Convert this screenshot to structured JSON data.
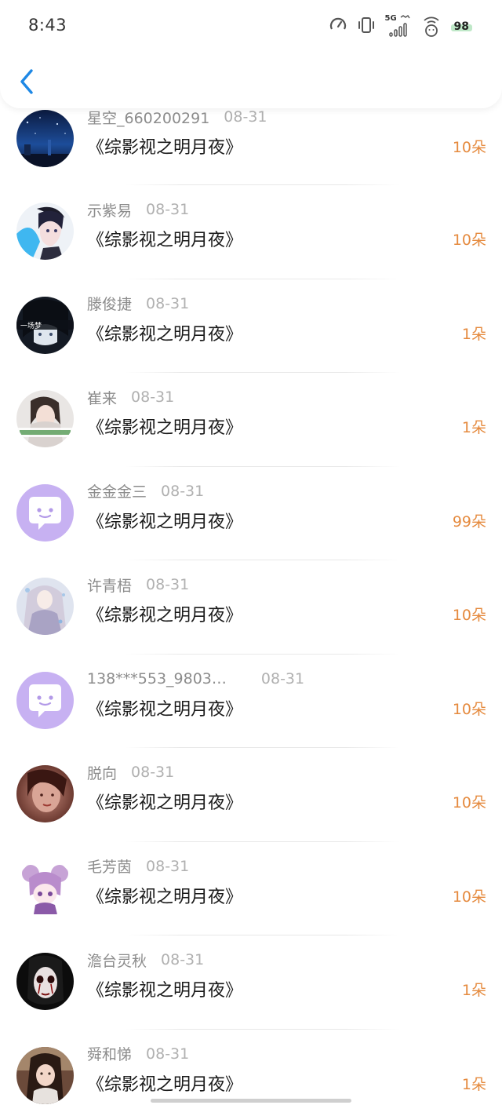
{
  "status_bar": {
    "time": "8:43",
    "network_label": "5G",
    "battery": "98"
  },
  "colors": {
    "accent_blue": "#1e88e5",
    "count_orange": "#e58a3e",
    "default_avatar_purple": "#c7b1f2"
  },
  "icons": {
    "back": "chevron-left-icon",
    "default_avatar": "chat-bubble-face-icon"
  },
  "gifts": [
    {
      "user": "星空_660200291",
      "date": "08-31",
      "book": "《综影视之明月夜》",
      "count": "10朵",
      "avatar": "night-sky-photo"
    },
    {
      "user": "示紫易",
      "date": "08-31",
      "book": "《综影视之明月夜》",
      "count": "10朵",
      "avatar": "anime-boy-blue-photo"
    },
    {
      "user": "滕俊捷",
      "date": "08-31",
      "book": "《综影视之明月夜》",
      "count": "1朵",
      "avatar": "dark-anime-photo",
      "avatar_text": "一场梦"
    },
    {
      "user": "崔来",
      "date": "08-31",
      "book": "《综影视之明月夜》",
      "count": "1朵",
      "avatar": "girl-portrait-photo"
    },
    {
      "user": "金金金三",
      "date": "08-31",
      "book": "《综影视之明月夜》",
      "count": "99朵",
      "avatar": "default-purple-avatar"
    },
    {
      "user": "许青梧",
      "date": "08-31",
      "book": "《综影视之明月夜》",
      "count": "10朵",
      "avatar": "anime-lady-white-photo"
    },
    {
      "user": "138***553_9803…",
      "date": "08-31",
      "book": "《综影视之明月夜》",
      "count": "10朵",
      "avatar": "default-purple-avatar"
    },
    {
      "user": "脱向",
      "date": "08-31",
      "book": "《综影视之明月夜》",
      "count": "10朵",
      "avatar": "red-face-photo"
    },
    {
      "user": "毛芳茵",
      "date": "08-31",
      "book": "《综影视之明月夜》",
      "count": "10朵",
      "avatar": "chibi-pink-hair-photo"
    },
    {
      "user": "澹台灵秋",
      "date": "08-31",
      "book": "《综影视之明月夜》",
      "count": "1朵",
      "avatar": "ghost-face-photo"
    },
    {
      "user": "舜和悌",
      "date": "08-31",
      "book": "《综影视之明月夜》",
      "count": "1朵",
      "avatar": "girl-selfie-photo"
    }
  ]
}
